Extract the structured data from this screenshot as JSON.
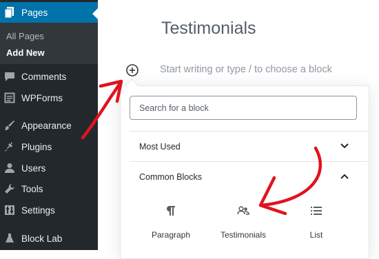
{
  "sidebar": {
    "pages_label": "Pages",
    "submenu": {
      "all_pages": "All Pages",
      "add_new": "Add New"
    },
    "items": [
      {
        "label": "Comments",
        "icon": "comment-icon"
      },
      {
        "label": "WPForms",
        "icon": "forms-icon"
      },
      {
        "label": "Appearance",
        "icon": "brush-icon"
      },
      {
        "label": "Plugins",
        "icon": "plugin-icon"
      },
      {
        "label": "Users",
        "icon": "user-icon"
      },
      {
        "label": "Tools",
        "icon": "wrench-icon"
      },
      {
        "label": "Settings",
        "icon": "settings-icon"
      },
      {
        "label": "Block Lab",
        "icon": "block-lab-icon"
      }
    ]
  },
  "editor": {
    "title": "Testimonials",
    "placeholder": "Start writing or type / to choose a block"
  },
  "inserter": {
    "search_placeholder": "Search for a block",
    "panels": {
      "most_used": "Most Used",
      "common_blocks": "Common Blocks"
    },
    "blocks": [
      {
        "label": "Paragraph",
        "icon": "paragraph-icon"
      },
      {
        "label": "Testimonials",
        "icon": "people-icon"
      },
      {
        "label": "List",
        "icon": "list-icon"
      }
    ]
  },
  "colors": {
    "sidebar": "#23282d",
    "active": "#0073aa",
    "annotation_arrow": "#e0141e"
  }
}
